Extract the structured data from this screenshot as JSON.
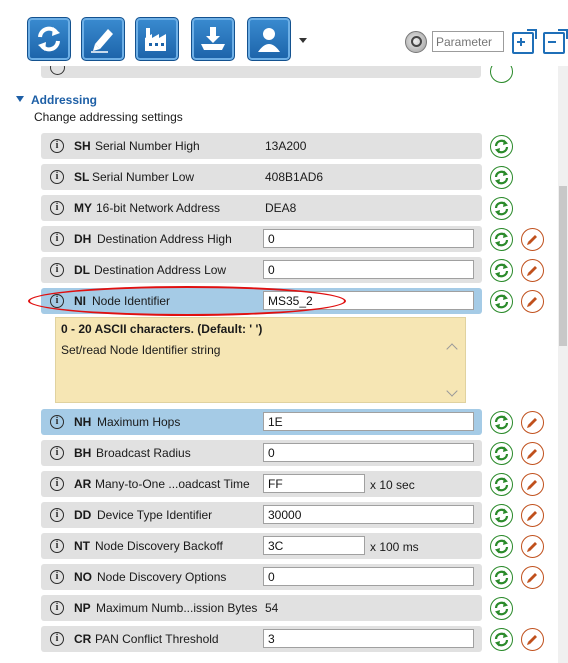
{
  "toolbar": {
    "buttons": [
      {
        "name": "read-button",
        "icon": "refresh-arrows-icon"
      },
      {
        "name": "write-button",
        "icon": "pencil-icon"
      },
      {
        "name": "default-button",
        "icon": "factory-icon"
      },
      {
        "name": "update-button",
        "icon": "download-tray-icon"
      },
      {
        "name": "profile-button",
        "icon": "user-icon"
      }
    ],
    "search_placeholder": "Parameter"
  },
  "section": {
    "title": "Addressing",
    "description": "Change addressing settings"
  },
  "rows": [
    {
      "code": "SH",
      "name": "Serial Number High",
      "value": "13A200",
      "editable": false
    },
    {
      "code": "SL",
      "name": "Serial Number Low",
      "value": "408B1AD6",
      "editable": false
    },
    {
      "code": "MY",
      "name": "16-bit Network Address",
      "value": "DEA8",
      "editable": false
    },
    {
      "code": "DH",
      "name": "Destination Address High",
      "value": "0",
      "editable": true
    },
    {
      "code": "DL",
      "name": "Destination Address Low",
      "value": "0",
      "editable": true
    },
    {
      "code": "NI",
      "name": "Node Identifier",
      "value": "MS35_2",
      "editable": true
    },
    {
      "code": "NH",
      "name": "Maximum Hops",
      "value": "1E",
      "editable": true
    },
    {
      "code": "BH",
      "name": "Broadcast Radius",
      "value": "0",
      "editable": true
    },
    {
      "code": "AR",
      "name": "Many-to-One ...oadcast Time",
      "value": "FF",
      "editable": true,
      "unit": "x 10 sec"
    },
    {
      "code": "DD",
      "name": "Device Type Identifier",
      "value": "30000",
      "editable": true
    },
    {
      "code": "NT",
      "name": "Node Discovery Backoff",
      "value": "3C",
      "editable": true,
      "unit": "x 100 ms"
    },
    {
      "code": "NO",
      "name": "Node Discovery Options",
      "value": "0",
      "editable": true
    },
    {
      "code": "NP",
      "name": "Maximum Numb...ission Bytes",
      "value": "54",
      "editable": false
    },
    {
      "code": "CR",
      "name": "PAN Conflict Threshold",
      "value": "3",
      "editable": true
    }
  ],
  "help": {
    "title": "0 - 20 ASCII characters. (Default: ' ')",
    "description": "Set/read Node Identifier string"
  },
  "colors": {
    "accent": "#1d5fa6",
    "row_bg": "#e1e1e1",
    "row_highlight": "#a5cbe6",
    "help_bg": "#f6e6b4",
    "annotation": "#e01010"
  }
}
